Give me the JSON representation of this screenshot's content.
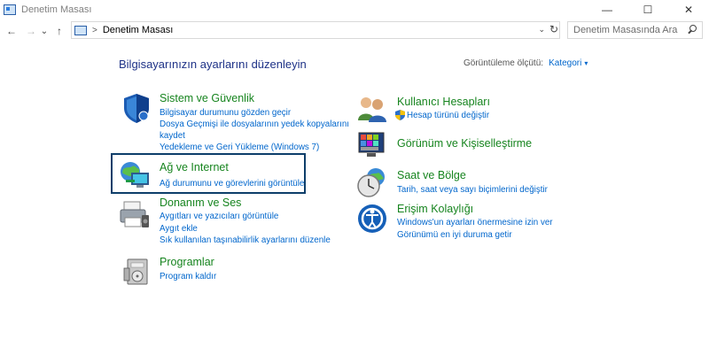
{
  "window": {
    "title": "Denetim Masası",
    "minimize_glyph": "—",
    "maximize_glyph": "☐",
    "close_glyph": "✕"
  },
  "nav": {
    "back_glyph": "←",
    "forward_glyph": "→",
    "recent_glyph": "⌄",
    "up_glyph": "↑",
    "address_sep": ">",
    "address_text": "Denetim Masası",
    "address_dropdown_glyph": "⌄",
    "refresh_glyph": "↻",
    "search_placeholder": "Denetim Masasında Ara"
  },
  "header": {
    "title": "Bilgisayarınızın ayarlarını düzenleyin",
    "view_label": "Görüntüleme ölçütü:",
    "view_value": "Kategori",
    "view_arrow": "▾"
  },
  "left_categories": [
    {
      "title": "Sistem ve Güvenlik",
      "icon": "shield-icon",
      "links": [
        "Bilgisayar durumunu gözden geçir",
        "Dosya Geçmişi ile dosyalarının yedek kopyalarını",
        "kaydet",
        "Yedekleme ve Geri Yükleme (Windows 7)"
      ]
    },
    {
      "title": "Ağ ve Internet",
      "icon": "network-globe-icon",
      "links": [
        "Ağ durumunu ve görevlerini görüntüle"
      ]
    },
    {
      "title": "Donanım ve Ses",
      "icon": "printer-speaker-icon",
      "links": [
        "Aygıtları ve yazıcıları görüntüle",
        "Aygıt ekle",
        "Sık kullanılan taşınabilirlik ayarlarını düzenle"
      ]
    },
    {
      "title": "Programlar",
      "icon": "programs-icon",
      "links": [
        "Program kaldır"
      ]
    }
  ],
  "right_categories": [
    {
      "title": "Kullanıcı Hesapları",
      "icon": "users-icon",
      "links": [
        "Hesap türünü değiştir"
      ]
    },
    {
      "title": "Görünüm ve Kişiselleştirme",
      "icon": "appearance-icon",
      "links": []
    },
    {
      "title": "Saat ve Bölge",
      "icon": "clock-globe-icon",
      "links": [
        "Tarih, saat veya sayı biçimlerini değiştir"
      ]
    },
    {
      "title": "Erişim Kolaylığı",
      "icon": "accessibility-icon",
      "links": [
        "Windows'un ayarları önermesine izin ver",
        "Görünümü en iyi duruma getir"
      ]
    }
  ],
  "colors": {
    "title_blue": "#1e3287",
    "category_green": "#16841e",
    "link_blue": "#0066cc",
    "highlight_border": "#0d3e6a"
  }
}
